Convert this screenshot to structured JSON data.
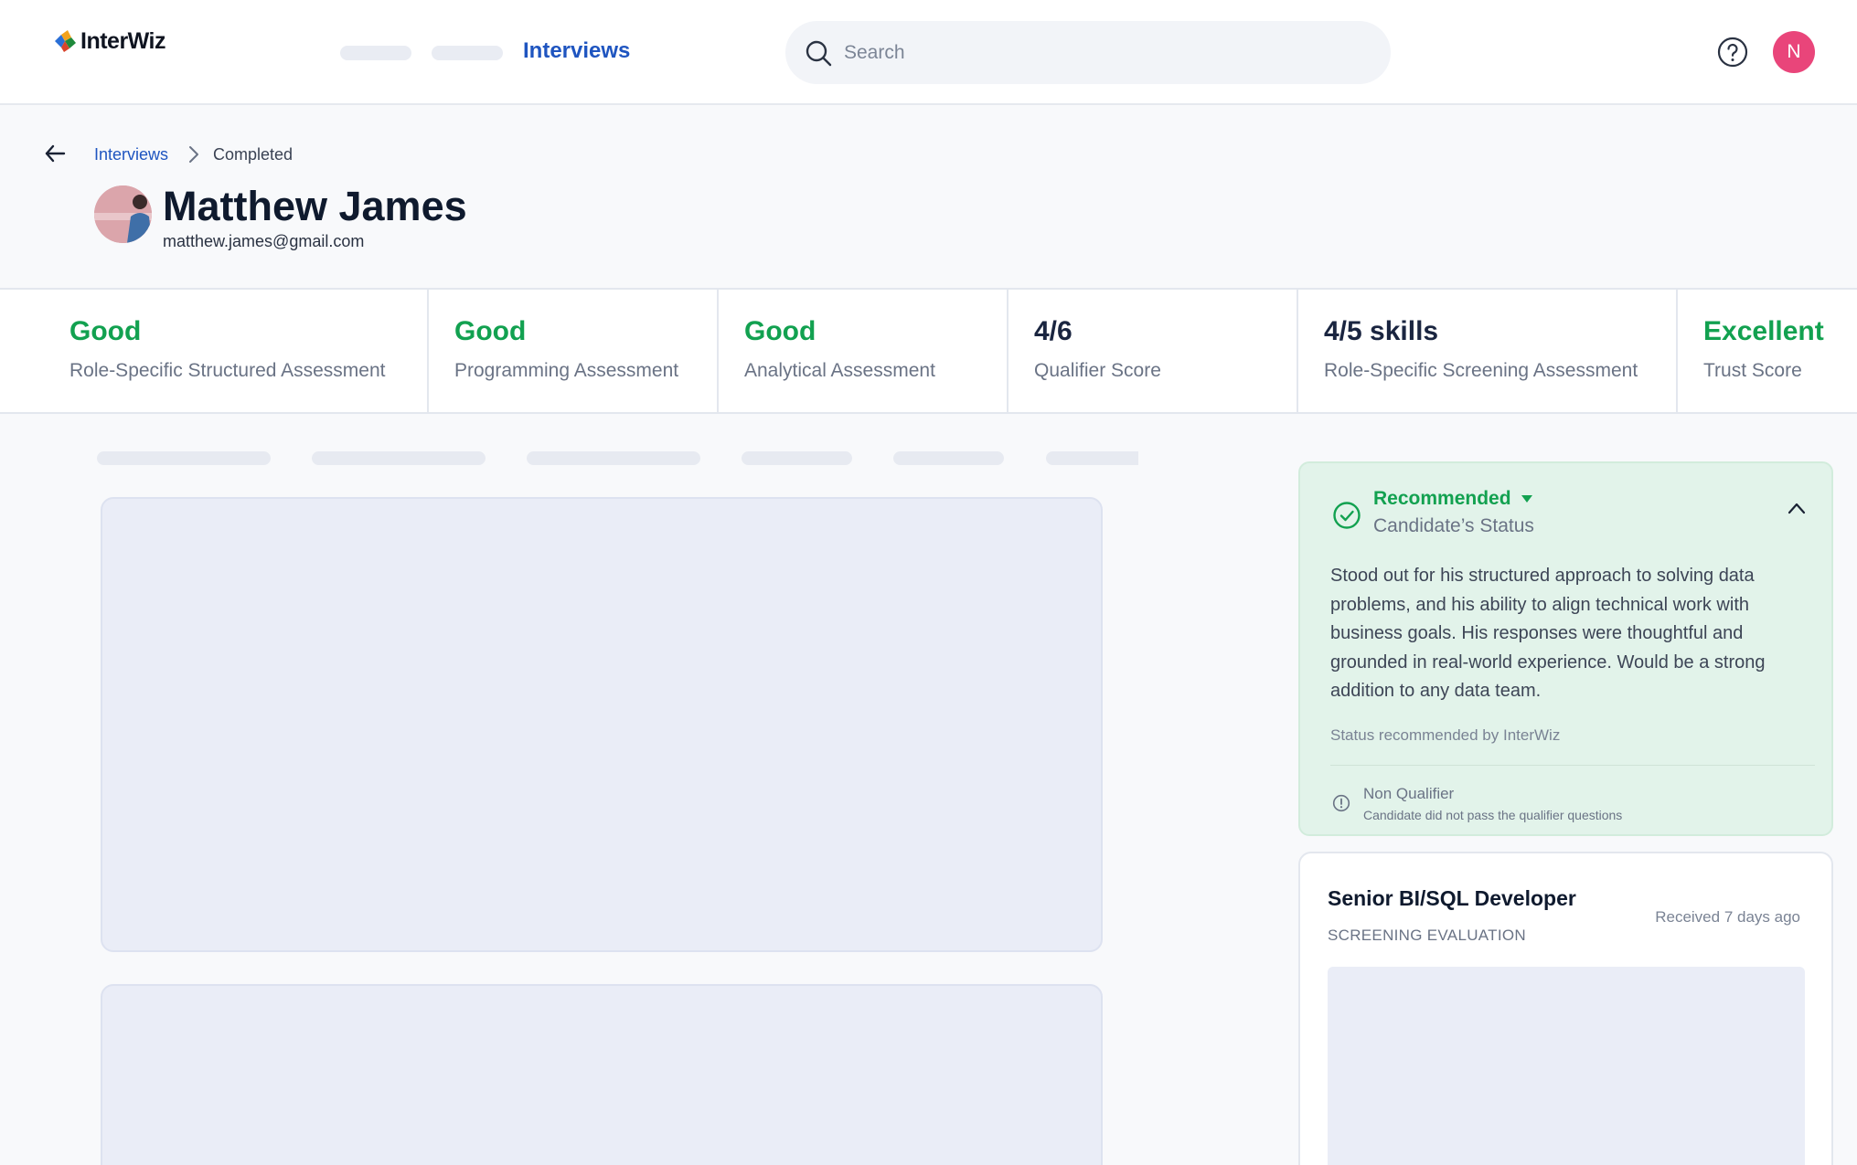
{
  "brand": {
    "name": "InterWiz"
  },
  "nav": {
    "active_label": "Interviews"
  },
  "search": {
    "placeholder": "Search"
  },
  "user": {
    "initial": "N"
  },
  "breadcrumb": {
    "parent": "Interviews",
    "current": "Completed"
  },
  "candidate": {
    "name": "Matthew James",
    "email": "matthew.james@gmail.com"
  },
  "scores": [
    {
      "value": "Good",
      "label": "Role-Specific Structured Assessment"
    },
    {
      "value": "Good",
      "label": "Programming Assessment"
    },
    {
      "value": "Good",
      "label": "Analytical Assessment"
    },
    {
      "value": "4/6",
      "label": "Qualifier Score"
    },
    {
      "value": "4/5 skills",
      "label": "Role-Specific Screening Assessment"
    },
    {
      "value": "Excellent",
      "label": "Trust Score"
    }
  ],
  "status": {
    "title": "Recommended",
    "subtitle": "Candidate’s Status",
    "summary": "Stood out for his structured approach to solving data problems, and his ability to align technical work with business goals. His responses were thoughtful and grounded in real-world experience. Would be a strong addition to any data team.",
    "recommended_by": "Status recommended by InterWiz",
    "qualifier_title": "Non Qualifier",
    "qualifier_note": "Candidate did not pass the qualifier questions"
  },
  "job": {
    "title": "Senior BI/SQL Developer",
    "subtitle": "SCREENING EVALUATION",
    "received": "Received 7 days ago"
  },
  "colors": {
    "accent": "#1f55c0",
    "success": "#12a150",
    "avatar": "#e9457a"
  }
}
